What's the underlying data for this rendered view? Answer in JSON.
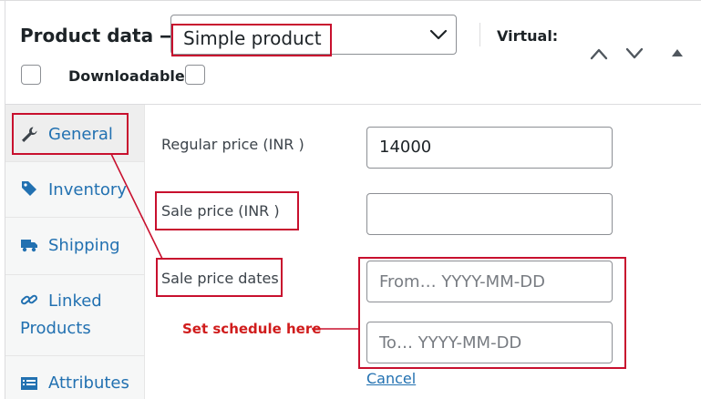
{
  "header": {
    "title": "Product data —",
    "product_type": "Simple product",
    "virtual_label": "Virtual:",
    "downloadable_label": "Downloadable:"
  },
  "sidebar": {
    "items": [
      {
        "label": "General",
        "icon": "wrench-icon"
      },
      {
        "label": "Inventory",
        "icon": "tag-icon"
      },
      {
        "label": "Shipping",
        "icon": "truck-icon"
      },
      {
        "label": "Linked",
        "label2": "Products",
        "icon": "link-icon"
      },
      {
        "label": "Attributes",
        "icon": "list-icon"
      }
    ]
  },
  "form": {
    "regular_price": {
      "label": "Regular price (INR )",
      "value": "14000"
    },
    "sale_price": {
      "label": "Sale price (INR )",
      "value": ""
    },
    "sale_dates": {
      "label": "Sale price dates",
      "from_placeholder": "From… YYYY-MM-DD",
      "to_placeholder": "To…  YYYY-MM-DD"
    },
    "cancel_label": "Cancel"
  },
  "annotation": {
    "text": "Set schedule here",
    "color": "#d01c1c"
  },
  "colors": {
    "link": "#2271b1",
    "annotation_box": "#c8102e",
    "sidebar_bg": "#f6f7f7"
  }
}
